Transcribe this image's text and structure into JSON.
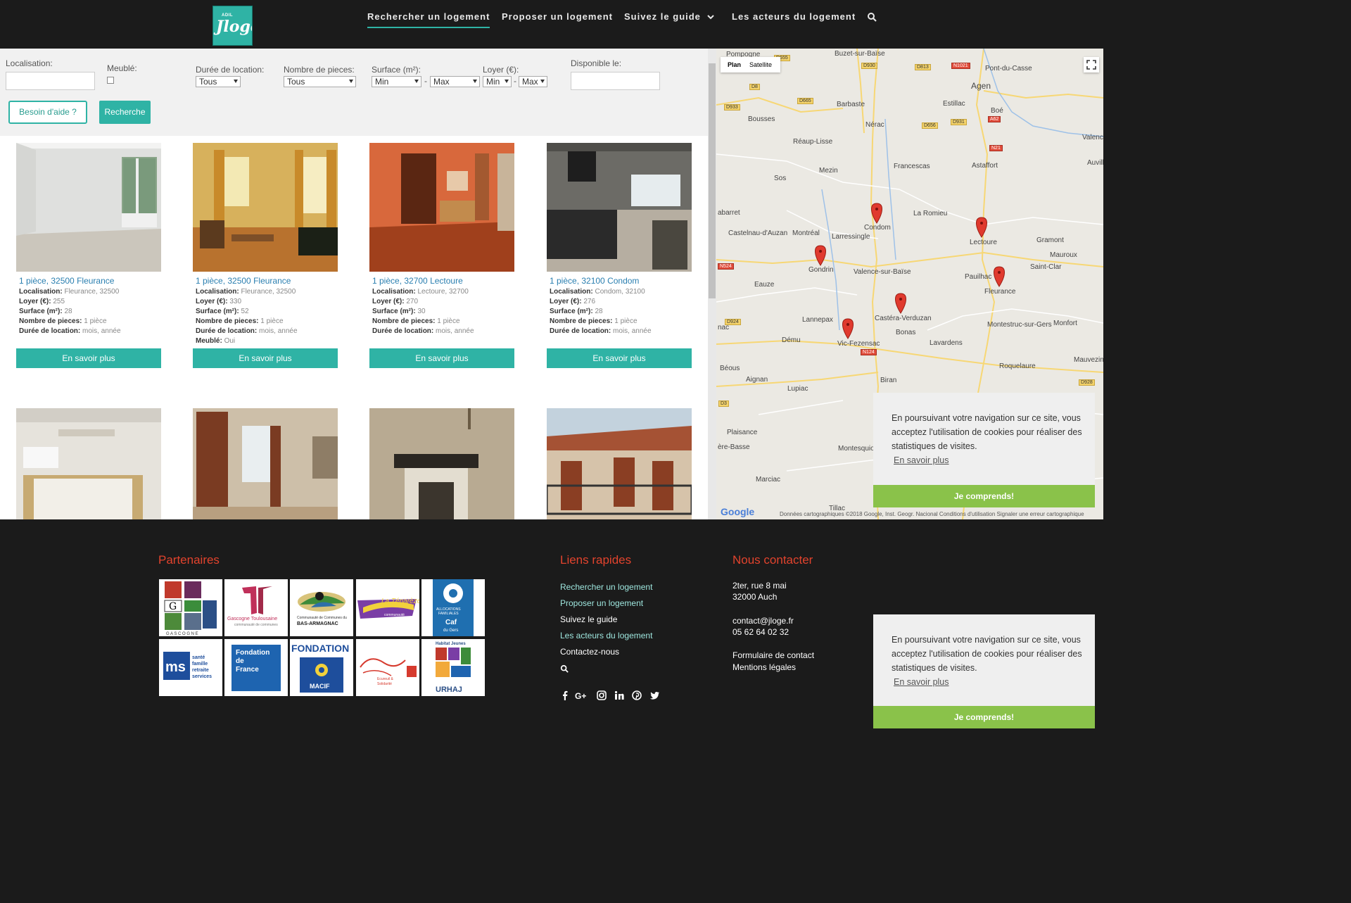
{
  "header": {
    "logo_small": "ADIL",
    "logo_main": "Jloge",
    "nav": [
      {
        "label": "Rechercher un logement",
        "active": true
      },
      {
        "label": "Proposer un logement"
      },
      {
        "label": "Suivez le guide"
      },
      {
        "label": "Les acteurs du logement"
      }
    ]
  },
  "search": {
    "localisation_label": "Localisation:",
    "meuble_label": "Meublé:",
    "duree_label": "Durée de location:",
    "duree_value": "Tous",
    "pieces_label": "Nombre de pieces:",
    "pieces_value": "Tous",
    "surface_label": "Surface (m²):",
    "surface_min": "Min",
    "surface_max": "Max",
    "loyer_label": "Loyer (€):",
    "loyer_min": "Min",
    "loyer_max": "Max",
    "disponible_label": "Disponible le:",
    "help_button": "Besoin d'aide ?",
    "search_button": "Recherche"
  },
  "listing_labels": {
    "localisation": "Localisation:",
    "loyer": "Loyer (€):",
    "surface": "Surface (m²):",
    "pieces": "Nombre de pieces:",
    "duree": "Durée de location:",
    "meuble": "Meublé:",
    "more": "En savoir plus"
  },
  "listings": [
    {
      "title": "1 pièce, 32500 Fleurance",
      "localisation": "Fleurance, 32500",
      "loyer": "255",
      "surface": "28",
      "pieces": "1 pièce",
      "duree": "mois, année"
    },
    {
      "title": "1 pièce, 32500 Fleurance",
      "localisation": "Fleurance, 32500",
      "loyer": "330",
      "surface": "52",
      "pieces": "1 pièce",
      "duree": "mois, année",
      "meuble": "Oui"
    },
    {
      "title": "1 pièce, 32700 Lectoure",
      "localisation": "Lectoure, 32700",
      "loyer": "270",
      "surface": "30",
      "pieces": "1 pièce",
      "duree": "mois, année"
    },
    {
      "title": "1 pièce, 32100 Condom",
      "localisation": "Condom, 32100",
      "loyer": "276",
      "surface": "28",
      "pieces": "1 pièce",
      "duree": "mois, année"
    }
  ],
  "map": {
    "tab_plan": "Plan",
    "tab_satellite": "Satellite",
    "google": "Google",
    "credit": "Données cartographiques ©2018 Google, Inst. Geogr. Nacional   Conditions d'utilisation   Signaler une erreur cartographique",
    "towns": [
      "Pompogne",
      "Buzet-sur-Baïse",
      "Pont-du-Casse",
      "Agen",
      "Barbaste",
      "Bousses",
      "Estillac",
      "Boé",
      "Nérac",
      "Valence-d'Agen",
      "Réaup-Lisse",
      "Astaffort",
      "Auvillar",
      "Francescas",
      "Mezin",
      "Sos",
      "La Romieu",
      "Condom",
      "Larressingle",
      "Castelnau-d'Auzan",
      "Montréal",
      "Lectoure",
      "Gramont",
      "Mauroux",
      "Saint-Clar",
      "Gondrin",
      "Valence-sur-Baïse",
      "Pauilhac",
      "Fleurance",
      "Eauze",
      "Castéra-Verduzan",
      "Lannepax",
      "Bonas",
      "Montestruc-sur-Gers",
      "Monfort",
      "Vic-Fezensac",
      "Dému",
      "Lavardens",
      "Roquelaure",
      "Béous",
      "Mauvezin",
      "Aignan",
      "Biran",
      "Lupiac",
      "Plaisance",
      "Marciac",
      "Montesquiou",
      "Tillac",
      "abarret",
      "nac",
      "ère-Basse"
    ],
    "roads": [
      "D655",
      "D930",
      "D813",
      "N1021",
      "D8",
      "D665",
      "D931",
      "D656",
      "A62",
      "D933",
      "N21",
      "N524",
      "D924",
      "N124",
      "D928",
      "D3"
    ]
  },
  "cookie": {
    "text": "En poursuivant votre navigation sur ce site, vous acceptez l'utilisation de cookies pour réaliser des statistiques de visites.",
    "link": "En savoir plus",
    "button": "Je comprends!"
  },
  "footer": {
    "partners_title": "Partenaires",
    "partners": [
      "Gers Gascogne",
      "Gascogne Toulousaine",
      "Bas-Armagnac",
      "La Ténarèze",
      "Caf du Gers",
      "MSA",
      "Fondation de France",
      "Fondation MACIF",
      "Écureuil & Solidarité",
      "URHAJ"
    ],
    "links_title": "Liens rapides",
    "links": [
      {
        "label": "Rechercher un logement",
        "color": "#9ee6de"
      },
      {
        "label": "Proposer un logement",
        "color": "#9ee6de"
      },
      {
        "label": "Suivez le guide",
        "color": "#ffffff"
      },
      {
        "label": "Les acteurs du logement",
        "color": "#9ee6de"
      },
      {
        "label": "Contactez-nous",
        "color": "#ffffff"
      }
    ],
    "contact_title": "Nous contacter",
    "address1": "2ter, rue 8 mai",
    "address2": "32000 Auch",
    "email": "contact@jloge.fr",
    "phone": "05 62 64 02 32",
    "form": "Formulaire de contact",
    "legal": "Mentions légales"
  }
}
